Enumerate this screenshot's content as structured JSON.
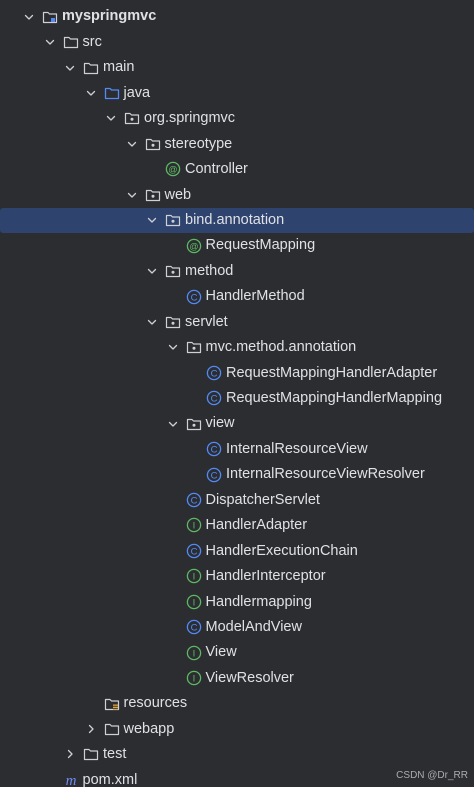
{
  "tree": {
    "items": [
      {
        "label": "myspringmvc",
        "level": 0,
        "chevron": "down",
        "icon": "module-folder-icon",
        "bold": true
      },
      {
        "label": "src",
        "level": 1,
        "chevron": "down",
        "icon": "folder-icon"
      },
      {
        "label": "main",
        "level": 2,
        "chevron": "down",
        "icon": "folder-icon"
      },
      {
        "label": "java",
        "level": 3,
        "chevron": "down",
        "icon": "source-folder-icon"
      },
      {
        "label": "org.springmvc",
        "level": 4,
        "chevron": "down",
        "icon": "package-icon"
      },
      {
        "label": "stereotype",
        "level": 5,
        "chevron": "down",
        "icon": "package-icon"
      },
      {
        "label": "Controller",
        "level": 6,
        "chevron": "none",
        "icon": "annotation-icon"
      },
      {
        "label": "web",
        "level": 5,
        "chevron": "down",
        "icon": "package-icon"
      },
      {
        "label": "bind.annotation",
        "level": 6,
        "chevron": "down",
        "icon": "package-icon",
        "selected": true
      },
      {
        "label": "RequestMapping",
        "level": 7,
        "chevron": "none",
        "icon": "annotation-icon"
      },
      {
        "label": "method",
        "level": 6,
        "chevron": "down",
        "icon": "package-icon"
      },
      {
        "label": "HandlerMethod",
        "level": 7,
        "chevron": "none",
        "icon": "class-icon"
      },
      {
        "label": "servlet",
        "level": 6,
        "chevron": "down",
        "icon": "package-icon"
      },
      {
        "label": "mvc.method.annotation",
        "level": 7,
        "chevron": "down",
        "icon": "package-icon"
      },
      {
        "label": "RequestMappingHandlerAdapter",
        "level": 8,
        "chevron": "none",
        "icon": "class-icon"
      },
      {
        "label": "RequestMappingHandlerMapping",
        "level": 8,
        "chevron": "none",
        "icon": "class-icon"
      },
      {
        "label": "view",
        "level": 7,
        "chevron": "down",
        "icon": "package-icon"
      },
      {
        "label": "InternalResourceView",
        "level": 8,
        "chevron": "none",
        "icon": "class-icon"
      },
      {
        "label": "InternalResourceViewResolver",
        "level": 8,
        "chevron": "none",
        "icon": "class-icon"
      },
      {
        "label": "DispatcherServlet",
        "level": 7,
        "chevron": "none",
        "icon": "class-icon"
      },
      {
        "label": "HandlerAdapter",
        "level": 7,
        "chevron": "none",
        "icon": "interface-icon"
      },
      {
        "label": "HandlerExecutionChain",
        "level": 7,
        "chevron": "none",
        "icon": "class-icon"
      },
      {
        "label": "HandlerInterceptor",
        "level": 7,
        "chevron": "none",
        "icon": "interface-icon"
      },
      {
        "label": "Handlermapping",
        "level": 7,
        "chevron": "none",
        "icon": "interface-icon"
      },
      {
        "label": "ModelAndView",
        "level": 7,
        "chevron": "none",
        "icon": "class-icon"
      },
      {
        "label": "View",
        "level": 7,
        "chevron": "none",
        "icon": "interface-icon"
      },
      {
        "label": "ViewResolver",
        "level": 7,
        "chevron": "none",
        "icon": "interface-icon"
      },
      {
        "label": "resources",
        "level": 3,
        "chevron": "none",
        "icon": "resources-folder-icon"
      },
      {
        "label": "webapp",
        "level": 3,
        "chevron": "right",
        "icon": "folder-icon"
      },
      {
        "label": "test",
        "level": 2,
        "chevron": "right",
        "icon": "folder-icon"
      },
      {
        "label": "pom.xml",
        "level": 1,
        "chevron": "none",
        "icon": "maven-icon"
      }
    ]
  },
  "watermark": "CSDN @Dr_RR",
  "colors": {
    "background": "#2b2d30",
    "selection": "#2e436e",
    "text": "#dfe1e5",
    "folder_stroke": "#ced0d6",
    "source_folder": "#548af7",
    "class": "#548af7",
    "annotation": "#5fb865",
    "interface": "#5fb865",
    "resources_marker": "#d9a343",
    "maven": "#6e8cf5"
  }
}
